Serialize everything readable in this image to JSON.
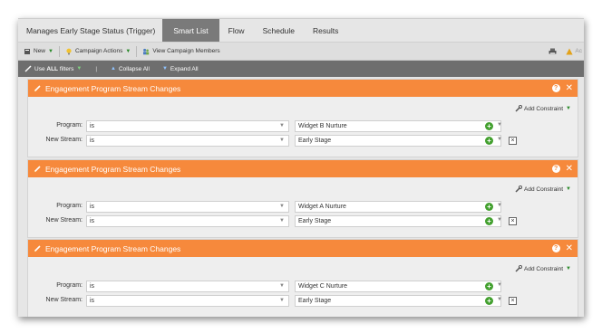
{
  "tabs": [
    {
      "label": "Manages Early Stage Status (Trigger)",
      "active": false
    },
    {
      "label": "Smart List",
      "active": true
    },
    {
      "label": "Flow",
      "active": false
    },
    {
      "label": "Schedule",
      "active": false
    },
    {
      "label": "Results",
      "active": false
    }
  ],
  "toolbar": {
    "new_label": "New",
    "campaign_actions_label": "Campaign Actions",
    "view_members_label": "View Campaign Members",
    "right_partial_label": "Ac"
  },
  "filterbar": {
    "use_prefix": "Use",
    "use_all": "ALL",
    "use_suffix": "filters",
    "separator": "|",
    "collapse_label": "Collapse All",
    "expand_label": "Expand All"
  },
  "filters": [
    {
      "title": "Engagement Program Stream Changes",
      "add_constraint": "Add Constraint",
      "rows": [
        {
          "label": "Program:",
          "operator": "is",
          "value": "Widget B Nurture"
        },
        {
          "label": "New Stream:",
          "operator": "is",
          "value": "Early Stage"
        }
      ]
    },
    {
      "title": "Engagement Program Stream Changes",
      "add_constraint": "Add Constraint",
      "rows": [
        {
          "label": "Program:",
          "operator": "is",
          "value": "Widget A Nurture"
        },
        {
          "label": "New Stream:",
          "operator": "is",
          "value": "Early Stage"
        }
      ]
    },
    {
      "title": "Engagement Program Stream Changes",
      "add_constraint": "Add Constraint",
      "rows": [
        {
          "label": "Program:",
          "operator": "is",
          "value": "Widget C Nurture"
        },
        {
          "label": "New Stream:",
          "operator": "is",
          "value": "Early Stage"
        }
      ]
    }
  ],
  "colors": {
    "filter_header": "#f6893c",
    "active_tab": "#7a7a7a",
    "filterbar_bg": "#6e6e6e",
    "add_green": "#43a02f"
  },
  "icons": {
    "new": "new-icon",
    "campaign_actions": "lightbulb-icon",
    "view_members": "people-icon",
    "print": "print-icon",
    "filter_edit": "pencil-icon",
    "help": "help-icon",
    "close": "close-icon",
    "add_constraint": "wrench-icon",
    "add": "plus-circle-icon",
    "delete": "delete-box-icon"
  }
}
